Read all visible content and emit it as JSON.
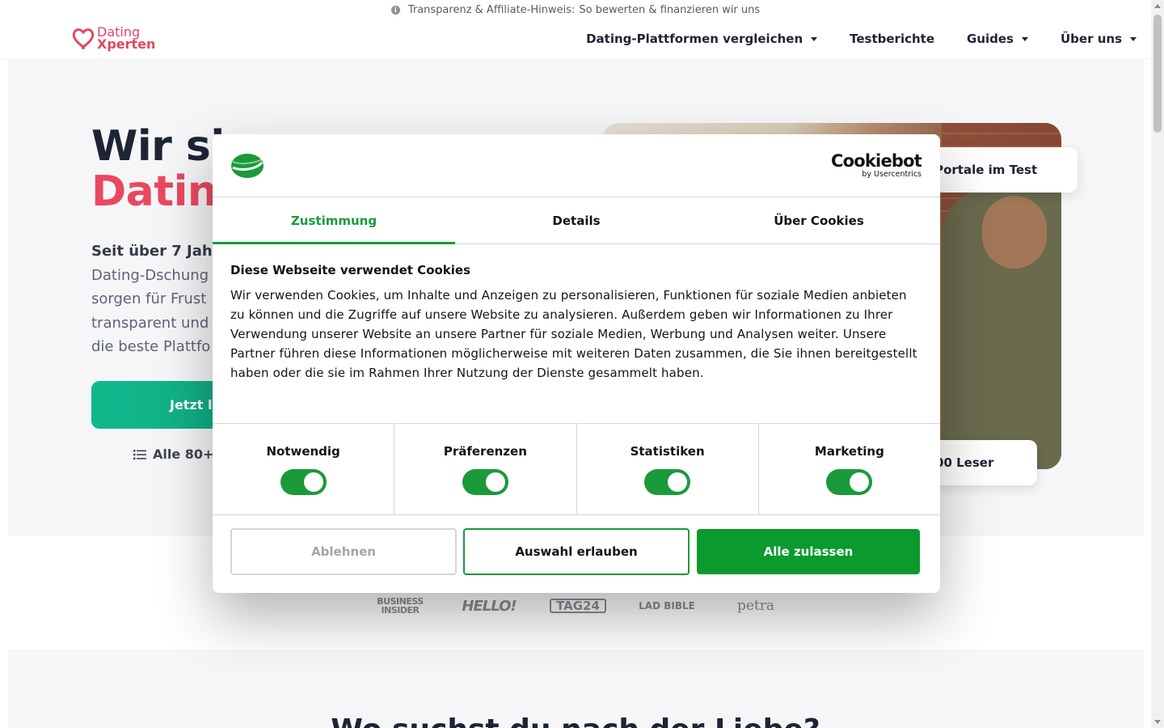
{
  "notice": {
    "label": "Transparenz & Affiliate-Hinweis:",
    "link": "So bewerten & finanzieren wir uns"
  },
  "logo": {
    "line1": "Dating",
    "line2": "Xperten"
  },
  "nav": [
    {
      "label": "Dating-Plattformen vergleichen",
      "dropdown": true
    },
    {
      "label": "Testberichte",
      "dropdown": false
    },
    {
      "label": "Guides",
      "dropdown": true
    },
    {
      "label": "Über uns",
      "dropdown": true
    }
  ],
  "hero": {
    "title_line1": "Wir si",
    "title_line2": "Datin",
    "lead_strong": "Seit über 7 Jahr",
    "lead_lines": [
      "Dating-Dschung",
      "sorgen für Frust",
      "transparent und",
      "die beste Plattfo"
    ],
    "cta_label": "Jetzt l",
    "link_label": "Alle 80+ T",
    "badge_portale": "80 Portale im Test",
    "badge_leser": "00.000 Leser"
  },
  "press": [
    "BUSINESS INSIDER",
    "HELLO!",
    "TAG24",
    "LAD BIBLE",
    "petra"
  ],
  "section2": {
    "title": "Wo suchst du nach der Liebe?"
  },
  "cookie": {
    "brand": "Cookiebot",
    "brand_sub": "by Usercentrics",
    "tabs": [
      "Zustimmung",
      "Details",
      "Über Cookies"
    ],
    "active_tab": "Zustimmung",
    "heading": "Diese Webseite verwendet Cookies",
    "text": "Wir verwenden Cookies, um Inhalte und Anzeigen zu personalisieren, Funktionen für soziale Medien anbieten zu können und die Zugriffe auf unsere Website zu analysieren. Außerdem geben wir Informationen zu Ihrer Verwendung unserer Website an unsere Partner für soziale Medien, Werbung und Analysen weiter. Unsere Partner führen diese Informationen möglicherweise mit weiteren Daten zusammen, die Sie ihnen bereitgestellt haben oder die sie im Rahmen Ihrer Nutzung der Dienste gesammelt haben.",
    "toggles": [
      {
        "label": "Notwendig",
        "on": true
      },
      {
        "label": "Präferenzen",
        "on": true
      },
      {
        "label": "Statistiken",
        "on": true
      },
      {
        "label": "Marketing",
        "on": true
      }
    ],
    "buttons": {
      "decline": "Ablehnen",
      "selection": "Auswahl erlauben",
      "allow_all": "Alle zulassen"
    }
  },
  "colors": {
    "brand_red": "#e9495f",
    "cta_green": "#12b88d",
    "cookiebot_green": "#1a9a3a"
  }
}
